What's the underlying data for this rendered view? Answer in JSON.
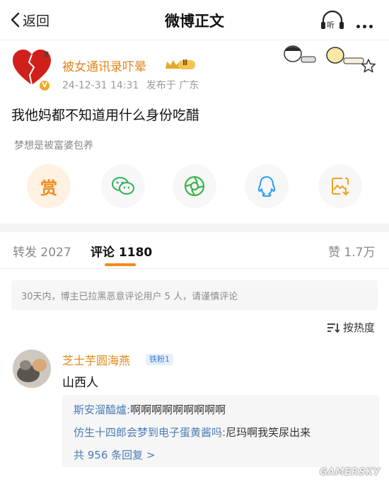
{
  "nav": {
    "back_label": "返回",
    "title": "微博正文",
    "listen_label": "听"
  },
  "post": {
    "username": "被女通讯录吓晕",
    "vip_level": "Ⅱ",
    "timestamp": "24-12-31 14:31",
    "location": "发布于 广东",
    "text": "我他妈都不知道用什么身份吃醋",
    "source": "梦想是被富婆包养",
    "avatar_badge": "V"
  },
  "share": {
    "reward_label": "赏",
    "icons": [
      "wechat-icon",
      "moments-icon",
      "qq-icon",
      "save-image-icon"
    ]
  },
  "tabs": {
    "repost_label": "转发",
    "repost_count": "2027",
    "comment_label": "评论",
    "comment_count": "1180",
    "like_label": "赞",
    "like_count": "1.7万"
  },
  "notice": "30天内，博主已拉黑恶意评论用户 5 人，请谨慎评论",
  "sort_label": "按热度",
  "comment": {
    "username": "芝士芋圆海燕",
    "fan_badge": "铁粉1",
    "text": "山西人",
    "replies": [
      {
        "name": "斯安溜醯爐:",
        "text": "啊啊啊啊啊啊啊啊啊"
      },
      {
        "name": "仿生十四郎会梦到电子蛋黄酱吗:",
        "text": "尼玛啊我笑尿出来"
      }
    ],
    "more_replies": "共 956 条回复 >"
  },
  "watermark": "GAMERSKY",
  "colors": {
    "username": "#e0861a",
    "accent": "#f08a1c",
    "link": "#4a7cb5"
  }
}
